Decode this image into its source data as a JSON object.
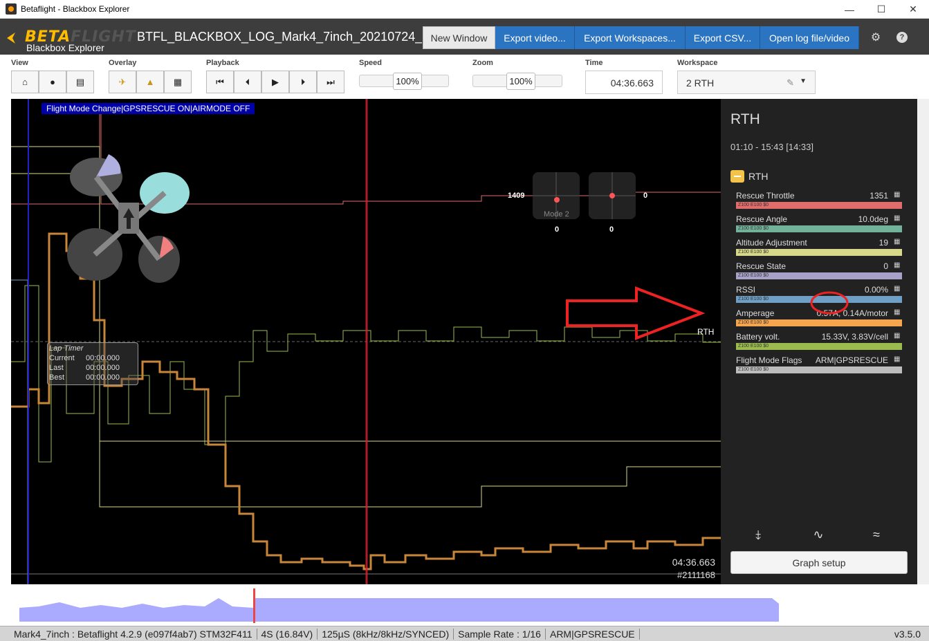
{
  "window": {
    "title": "Betaflight - Blackbox Explorer",
    "minimize": "—",
    "maximize": "☐",
    "close": "✕"
  },
  "header": {
    "logo_main": "BETA",
    "logo_accent": "FLIGHT",
    "logo_sub": "Blackbox Explorer",
    "filename": "BTFL_BLACKBOX_LOG_Mark4_7inch_20210724_",
    "buttons": {
      "new_window": "New Window",
      "export_video": "Export video...",
      "export_workspaces": "Export Workspaces...",
      "export_csv": "Export CSV...",
      "open_log": "Open log file/video"
    },
    "gear": "⚙",
    "help": "?"
  },
  "toolbar": {
    "view_label": "View",
    "overlay_label": "Overlay",
    "playback_label": "Playback",
    "speed_label": "Speed",
    "speed_value": "100%",
    "zoom_label": "Zoom",
    "zoom_value": "100%",
    "time_label": "Time",
    "time_value": "04:36.663",
    "workspace_label": "Workspace",
    "workspace_value": "2 RTH"
  },
  "graph": {
    "flight_mode_change": "Flight Mode Change|GPSRESCUE ON|AIRMODE OFF",
    "stick_left_value": "1409",
    "stick_mode": "Mode 2",
    "stick_left_bottom": "0",
    "stick_right_value": "0",
    "stick_right_bottom": "0",
    "lap_timer": {
      "title": "Lap Timer",
      "current_label": "Current",
      "current": "00:00.000",
      "last_label": "Last",
      "last": "00:00.000",
      "best_label": "Best",
      "best": "00:00.000"
    },
    "rth_label": "RTH",
    "time": "04:36.663",
    "frame": "#2111168"
  },
  "sidebar": {
    "title": "RTH",
    "range": "01:10 - 15:43 [14:33]",
    "group": "RTH",
    "fields": [
      {
        "name": "Rescue Throttle",
        "value": "1351",
        "bar": "Z100 E100 $0",
        "color": "#e06c6c"
      },
      {
        "name": "Rescue Angle",
        "value": "10.0deg",
        "bar": "Z100 E100 $0",
        "color": "#72b29a"
      },
      {
        "name": "Altitude Adjustment",
        "value": "19",
        "bar": "Z100 E100 $0",
        "color": "#d8d88a"
      },
      {
        "name": "Rescue State",
        "value": "0",
        "bar": "Z100 E100 $0",
        "color": "#a8a2c8"
      },
      {
        "name": "RSSI",
        "value": "0.00%",
        "bar": "Z100 E100 $0",
        "color": "#6f9fc4"
      },
      {
        "name": "Amperage",
        "value": "0.57A, 0.14A/motor",
        "bar": "Z100 E100 $0",
        "color": "#f6a54f"
      },
      {
        "name": "Battery volt.",
        "value": "15.33V, 3.83V/cell",
        "bar": "Z100 E100 $0",
        "color": "#9bbb4e"
      },
      {
        "name": "Flight Mode Flags",
        "value": "ARM|GPSRESCUE",
        "bar": "Z100 E100 $0",
        "color": "#bdbdbd"
      }
    ],
    "graph_setup": "Graph setup"
  },
  "status": {
    "craft": "Mark4_7inch : Betaflight 4.2.9 (e097f4ab7) STM32F411",
    "cells": "4S (16.84V)",
    "looptime": "125µS (8kHz/8kHz/SYNCED)",
    "sample_rate": "Sample Rate : 1/16",
    "flags": "ARM|GPSRESCUE",
    "version": "v3.5.0"
  }
}
